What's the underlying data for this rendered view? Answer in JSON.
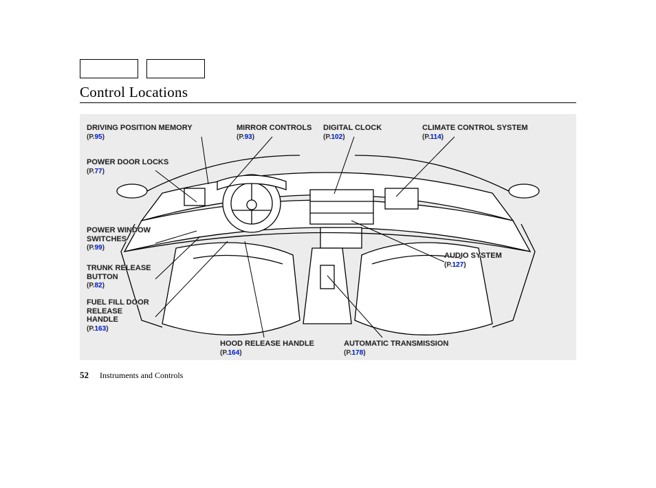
{
  "title": "Control Locations",
  "page_number": "52",
  "section": "Instruments and Controls",
  "page_prefix": "(P.",
  "page_suffix": ")",
  "labels": {
    "driving_position_memory": {
      "text": "DRIVING POSITION MEMORY",
      "page": "95"
    },
    "mirror_controls": {
      "text": "MIRROR CONTROLS",
      "page": "93"
    },
    "digital_clock": {
      "text": "DIGITAL CLOCK",
      "page": "102"
    },
    "climate_control_system": {
      "text": "CLIMATE CONTROL SYSTEM",
      "page": "114"
    },
    "power_door_locks": {
      "text": "POWER DOOR LOCKS",
      "page": "77"
    },
    "power_window_switches": {
      "text": "POWER WINDOW SWITCHES",
      "page": "99"
    },
    "trunk_release_button": {
      "text": "TRUNK RELEASE BUTTON",
      "page": "82"
    },
    "fuel_fill_door_release_handle": {
      "text": "FUEL FILL DOOR RELEASE HANDLE",
      "page": "163"
    },
    "hood_release_handle": {
      "text": "HOOD RELEASE HANDLE",
      "page": "164"
    },
    "automatic_transmission": {
      "text": "AUTOMATIC TRANSMISSION",
      "page": "178"
    },
    "audio_system": {
      "text": "AUDIO SYSTEM",
      "page": "127"
    }
  }
}
